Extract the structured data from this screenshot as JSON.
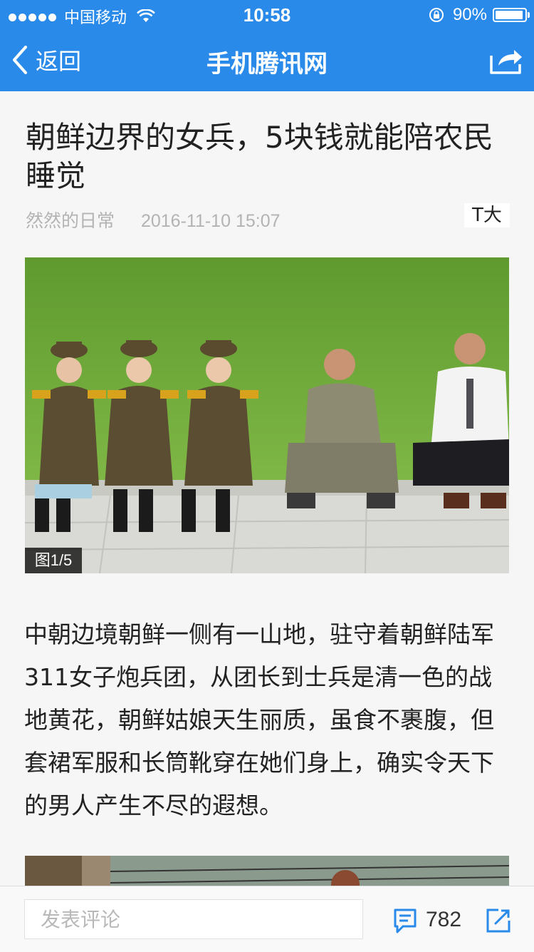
{
  "status_bar": {
    "carrier": "中国移动",
    "time": "10:58",
    "battery": "90%"
  },
  "nav": {
    "back_label": "返回",
    "title": "手机腾讯网"
  },
  "article": {
    "title": "朝鲜边界的女兵，5块钱就能陪农民睡觉",
    "author": "然然的日常",
    "datetime": "2016-11-10 15:07",
    "font_size_button": "T大",
    "image_counter": "图1/5",
    "body": "中朝边境朝鲜一侧有一山地，驻守着朝鲜陆军311女子炮兵团，从团长到士兵是清一色的战地黄花，朝鲜姑娘天生丽质，虽食不裹腹，但套裙军服和长筒靴穿在她们身上，确实令天下的男人产生不尽的遐想。"
  },
  "bottom_bar": {
    "comment_placeholder": "发表评论",
    "comment_count": "782"
  },
  "colors": {
    "brand": "#2a8aea",
    "icon_blue": "#2a8aea"
  }
}
